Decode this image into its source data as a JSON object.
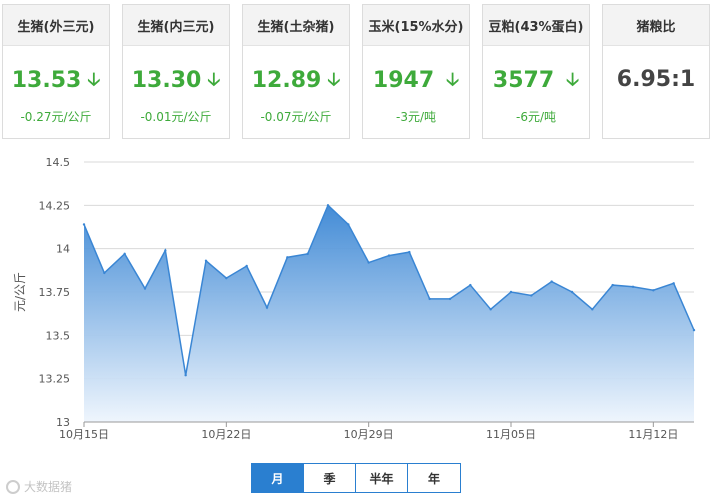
{
  "cards": [
    {
      "label": "生猪(外三元)",
      "price": "13.53",
      "arrow": "down-arrow",
      "change": "-0.27元/公斤"
    },
    {
      "label": "生猪(内三元)",
      "price": "13.30",
      "arrow": "down-arrow",
      "change": "-0.01元/公斤"
    },
    {
      "label": "生猪(土杂猪)",
      "price": "12.89",
      "arrow": "down-arrow",
      "change": "-0.07元/公斤"
    },
    {
      "label": "玉米(15%水分)",
      "price": "1947",
      "arrow": "down-arrow",
      "change": "-3元/吨"
    },
    {
      "label": "豆粕(43%蛋白)",
      "price": "3577",
      "arrow": "down-arrow",
      "change": "-6元/吨"
    },
    {
      "label": "猪粮比",
      "price": "6.95:1",
      "change": ""
    }
  ],
  "colors": {
    "down": "#3eaa3b",
    "line": "#3a86d4",
    "fill_top": "#3a86d4",
    "fill_bottom": "#eef5fd",
    "accent": "#2a7fd0"
  },
  "chart_data": {
    "type": "area",
    "title": "",
    "xlabel": "",
    "ylabel": "元/公斤",
    "ylim": [
      13,
      14.5
    ],
    "y_ticks": [
      "13",
      "13.25",
      "13.5",
      "13.75",
      "14",
      "14.25",
      "14.5"
    ],
    "x_tick_labels": [
      "10月15日",
      "10月22日",
      "10月29日",
      "11月05日",
      "11月12日"
    ],
    "x_start": "2018-10-15",
    "grid": true,
    "legend": "none",
    "series": [
      {
        "x": [
          "2018-10-15",
          "2018-10-16",
          "2018-10-17",
          "2018-10-18",
          "2018-10-19",
          "2018-10-20",
          "2018-10-21",
          "2018-10-22",
          "2018-10-23",
          "2018-10-24",
          "2018-10-25",
          "2018-10-26",
          "2018-10-27",
          "2018-10-28",
          "2018-10-29",
          "2018-10-30",
          "2018-10-31",
          "2018-11-01",
          "2018-11-02",
          "2018-11-03",
          "2018-11-04",
          "2018-11-05",
          "2018-11-06",
          "2018-11-07",
          "2018-11-08",
          "2018-11-09",
          "2018-11-10",
          "2018-11-11",
          "2018-11-12",
          "2018-11-13",
          "2018-11-14"
        ],
        "values": [
          14.14,
          13.86,
          13.97,
          13.77,
          13.99,
          13.27,
          13.93,
          13.83,
          13.9,
          13.66,
          13.95,
          13.97,
          14.25,
          14.14,
          13.92,
          13.96,
          13.98,
          13.71,
          13.71,
          13.79,
          13.65,
          13.75,
          13.73,
          13.81,
          13.75,
          13.65,
          13.79,
          13.78,
          13.76,
          13.8,
          13.53
        ]
      }
    ]
  },
  "period_tabs": [
    {
      "label": "月",
      "active": true
    },
    {
      "label": "季",
      "active": false
    },
    {
      "label": "半年",
      "active": false
    },
    {
      "label": "年",
      "active": false
    }
  ],
  "watermark": {
    "text": "大数据猪"
  }
}
